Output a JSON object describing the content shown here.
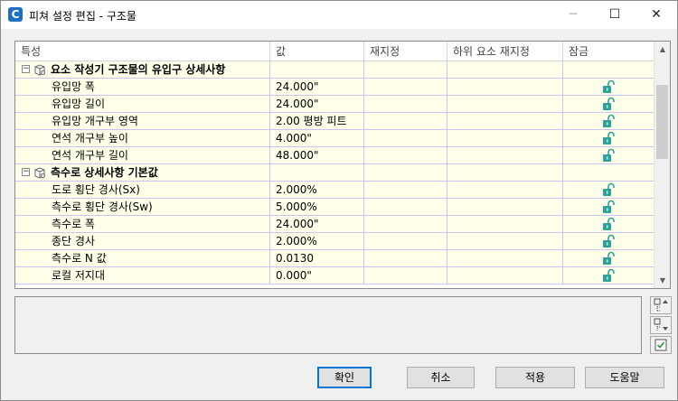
{
  "window": {
    "title": "피쳐 설정 편집 - 구조물",
    "app_icon_letter": "C",
    "minimize_icon": "minimize-icon",
    "maximize_icon": "maximize-icon",
    "close_icon": "close-icon"
  },
  "grid": {
    "columns": [
      "특성",
      "값",
      "재지정",
      "하위 요소 재지정",
      "잠금"
    ],
    "rows": [
      {
        "kind": "category",
        "label": "요소 작성기 구조물의 유입구 상세사항"
      },
      {
        "kind": "item",
        "label": "유입망 폭",
        "value": "24.000\"",
        "lock": "unlock-icon"
      },
      {
        "kind": "item",
        "label": "유입망 길이",
        "value": "24.000\"",
        "lock": "unlock-icon"
      },
      {
        "kind": "item",
        "label": "유입망 개구부 영역",
        "value": "2.00 평방 피트",
        "lock": "unlock-icon"
      },
      {
        "kind": "item",
        "label": "연석 개구부 높이",
        "value": "4.000\"",
        "lock": "unlock-icon"
      },
      {
        "kind": "item",
        "label": "연석 개구부 길이",
        "value": "48.000\"",
        "lock": "unlock-icon"
      },
      {
        "kind": "category",
        "label": "측수로 상세사항 기본값"
      },
      {
        "kind": "item",
        "label": "도로 횡단 경사(Sx)",
        "value": "2.000%",
        "lock": "unlock-icon"
      },
      {
        "kind": "item",
        "label": "측수로 횡단 경사(Sw)",
        "value": "5.000%",
        "lock": "unlock-icon"
      },
      {
        "kind": "item",
        "label": "측수로 폭",
        "value": "24.000\"",
        "lock": "unlock-icon"
      },
      {
        "kind": "item",
        "label": "종단 경사",
        "value": "2.000%",
        "lock": "unlock-icon"
      },
      {
        "kind": "item",
        "label": "측수로 N 값",
        "value": "0.0130",
        "lock": "unlock-icon"
      },
      {
        "kind": "item",
        "label": "로컬 저지대",
        "value": "0.000\"",
        "lock": "unlock-icon"
      }
    ]
  },
  "buttons": {
    "ok": "확인",
    "cancel": "취소",
    "apply": "적용",
    "help": "도움말"
  },
  "colors": {
    "row_bg": "#ffffea",
    "row_line": "#c6c6f0",
    "lock_color": "#2aa39a",
    "default_button_border": "#0078d7"
  }
}
